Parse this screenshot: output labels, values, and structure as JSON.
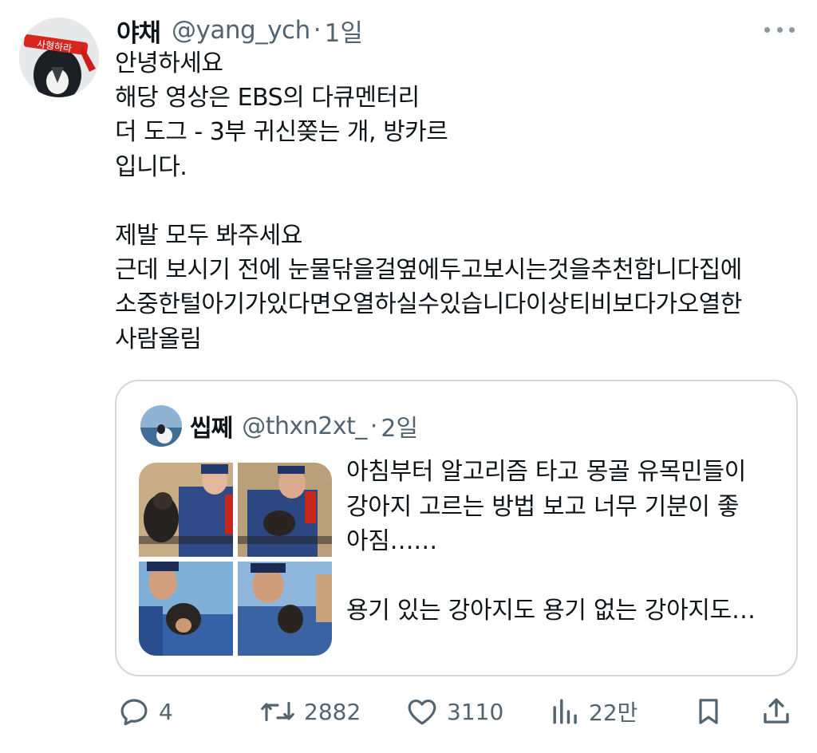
{
  "tweet": {
    "author_name": "야채",
    "author_handle": "@yang_ych",
    "separator": "·",
    "time": "1일",
    "avatar_headband_text": "사형하라",
    "text": "안녕하세요\n해당 영상은 EBS의 다큐멘터리\n더 도그 - 3부 귀신쫒는 개, 방카르\n입니다.\n\n제발 모두 봐주세요\n근데 보시기 전에 눈물닦을걸옆에두고보시는것을추천합니다집에\n소중한털아기가있다면오열하실수있습니다이상티비보다가오열한\n사람올림"
  },
  "quoted": {
    "author_name": "씹쩨",
    "author_handle": "@thxn2xt_",
    "separator": "·",
    "time": "2일",
    "text": "아침부터 알고리즘 타고 몽골 유목민들이\n강아지 고르는 방법 보고 너무 기분이 좋\n아짐……\n\n용기 있는 강아지도 용기 없는 강아지도…"
  },
  "actions": {
    "replies": "4",
    "retweets": "2882",
    "likes": "3110",
    "views": "22만"
  },
  "colors": {
    "text": "#0f1419",
    "secondary": "#536471",
    "border": "#cfd9de"
  },
  "icons": [
    "more-icon",
    "reply-icon",
    "retweet-icon",
    "like-icon",
    "views-icon",
    "bookmark-icon",
    "share-icon"
  ]
}
